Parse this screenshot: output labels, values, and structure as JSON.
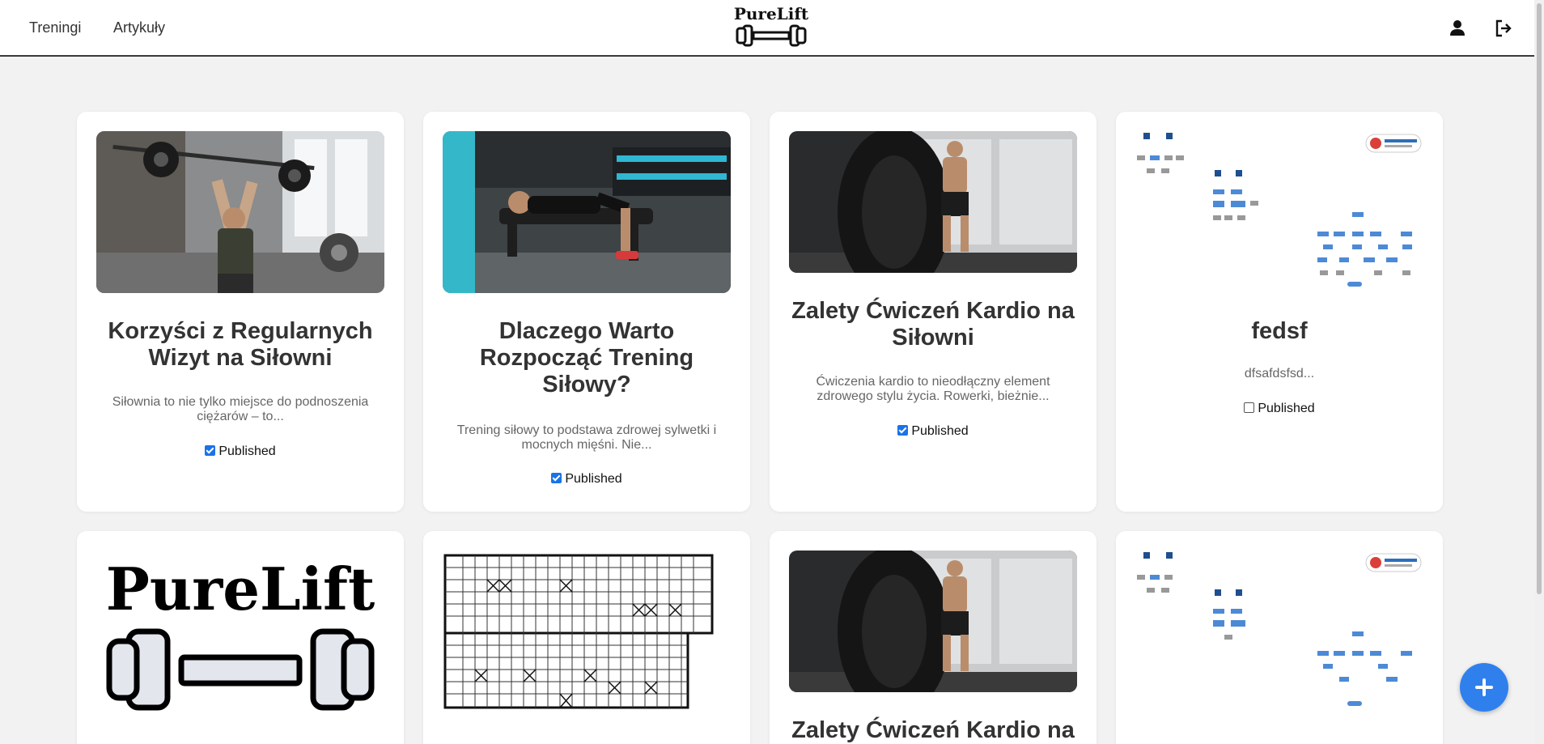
{
  "nav": {
    "links": [
      "Treningi",
      "Artykuły"
    ],
    "brand": "PureLift",
    "user_icon": "user-icon",
    "logout_icon": "logout-icon"
  },
  "articles": [
    {
      "title": "Korzyści z Regularnych Wizyt na Siłowni",
      "excerpt": "Siłownia to nie tylko miejsce do podnoszenia ciężarów – to...",
      "published": true,
      "published_label": "Published",
      "image": "photo-overhead-barbell-press"
    },
    {
      "title": "Dlaczego Warto Rozpocząć Trening Siłowy?",
      "excerpt": "Trening siłowy to podstawa zdrowej sylwetki i mocnych mięśni. Nie...",
      "published": true,
      "published_label": "Published",
      "image": "photo-hip-thrust-gym"
    },
    {
      "title": "Zalety Ćwiczeń Kardio na Siłowni",
      "excerpt": "Ćwiczenia kardio to nieodłączny element zdrowego stylu życia. Rowerki, bieżnie...",
      "published": true,
      "published_label": "Published",
      "image": "photo-tire-flip"
    },
    {
      "title": "fedsf",
      "excerpt": "dfsafdsfsd...",
      "published": false,
      "published_label": "Published",
      "image": "uml-diagram"
    },
    {
      "title": "",
      "excerpt": "",
      "published": null,
      "published_label": "",
      "image": "purelift-logo",
      "logo_text": "PureLift"
    },
    {
      "title": "",
      "excerpt": "",
      "published": null,
      "published_label": "",
      "image": "grid-table-scan"
    },
    {
      "title": "Zalety Ćwiczeń Kardio na",
      "excerpt": "",
      "published": null,
      "published_label": "",
      "image": "photo-tire-flip"
    },
    {
      "title": "",
      "excerpt": "",
      "published": null,
      "published_label": "",
      "image": "uml-diagram"
    }
  ],
  "fab": {
    "icon": "plus-icon"
  },
  "colors": {
    "accent": "#2f80ed",
    "checkbox": "#1a73e8",
    "background": "#f2f2f2"
  }
}
